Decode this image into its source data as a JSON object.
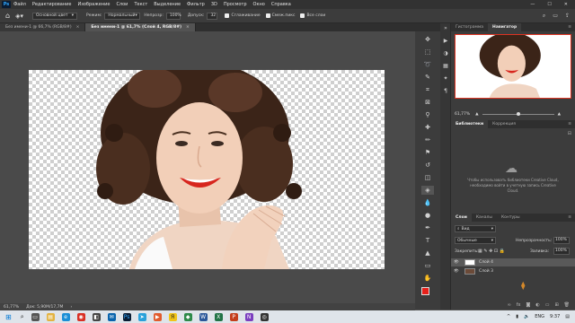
{
  "app": {
    "logo": "Ps"
  },
  "menu": [
    "Файл",
    "Редактирование",
    "Изображение",
    "Слои",
    "Текст",
    "Выделение",
    "Фильтр",
    "3D",
    "Просмотр",
    "Окно",
    "Справка"
  ],
  "window_controls": [
    "—",
    "☐",
    "✕"
  ],
  "options": {
    "mode_value": "Основной цвет",
    "blend_label": "Режим:",
    "blend_value": "Нормальный",
    "opacity_label": "Непрозр:",
    "opacity_value": "100%",
    "tolerance_label": "Допуск:",
    "tolerance_value": "32",
    "antialias_label": "Сглаживание",
    "contiguous_label": "Смеж.пикс",
    "all_layers_label": "Все слои"
  },
  "tabs": [
    {
      "label": "Без имени-1 @ 66,7% (RGB/8#)",
      "active": false
    },
    {
      "label": "Без имени-1 @ 61,7% (Слой 4, RGB/8#)",
      "active": true
    }
  ],
  "status": {
    "zoom": "61,77%",
    "doc": "Док: 5,90М/17,7М",
    "arrow": "›"
  },
  "navigator": {
    "tabs": [
      "Гистограмма",
      "Навигатор"
    ],
    "active": "Навигатор",
    "zoom": "61,77%"
  },
  "libraries": {
    "tabs": [
      "Библиотеки",
      "Коррекция"
    ],
    "active": "Библиотеки",
    "message": "Чтобы использовать библиотеки Creative Cloud, необходимо войти в учетную запись Creative Cloud."
  },
  "layers": {
    "tabs": [
      "Слои",
      "Каналы",
      "Контуры"
    ],
    "active": "Слои",
    "filter_label": "Вид",
    "blend_value": "Обычные",
    "opacity_label": "Непрозрачность:",
    "opacity_value": "100%",
    "lock_label": "Закрепить:",
    "fill_label": "Заливка:",
    "fill_value": "100%",
    "items": [
      {
        "name": "Слой 4",
        "selected": true
      },
      {
        "name": "Слой 3",
        "selected": false
      }
    ]
  },
  "taskbar": {
    "lang": "ENG",
    "time": "9:37",
    "start_icon": "windows-icon"
  },
  "colors": {
    "accent": "#31a8ff",
    "foreground": "#e6201a",
    "background": "#ffffff"
  }
}
